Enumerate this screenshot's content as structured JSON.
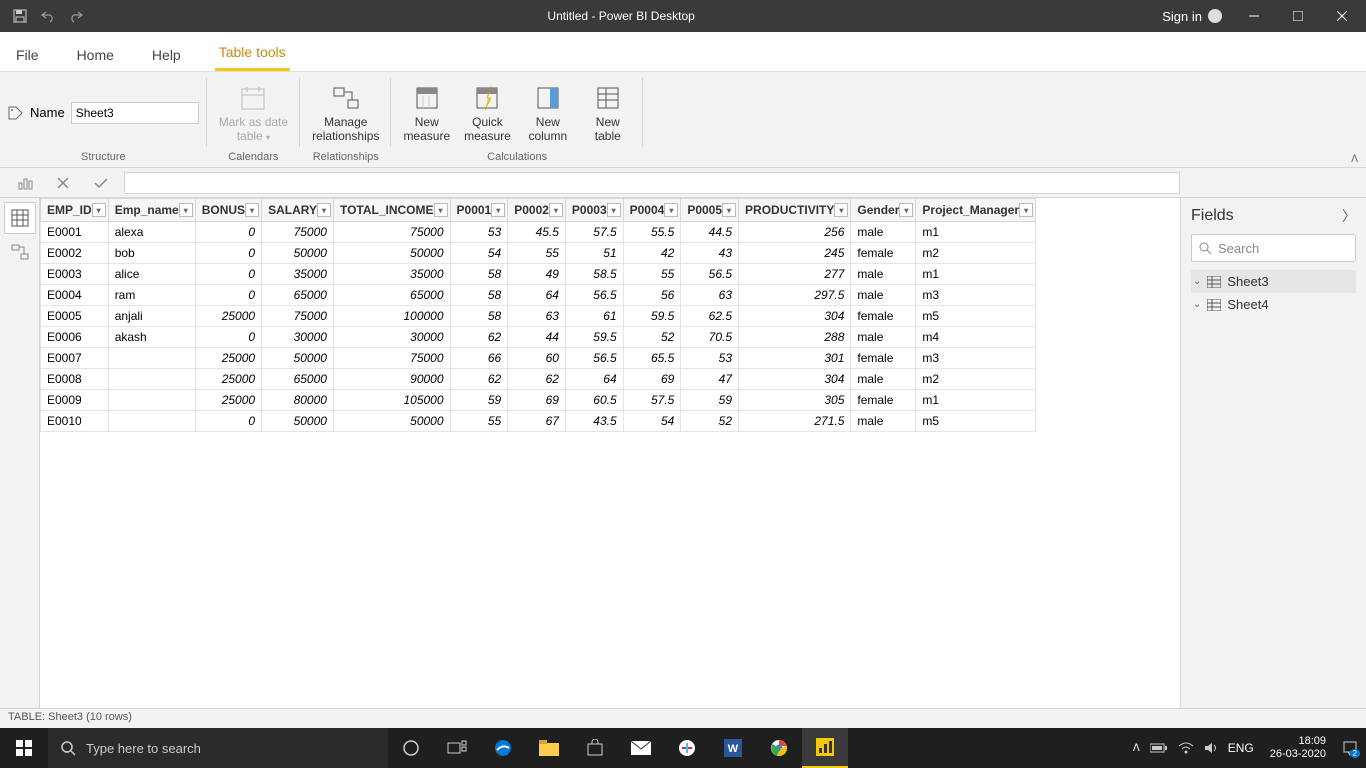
{
  "titlebar": {
    "title": "Untitled - Power BI Desktop",
    "signin": "Sign in"
  },
  "menu": {
    "file": "File",
    "home": "Home",
    "help": "Help",
    "tabletools": "Table tools"
  },
  "ribbon": {
    "name_label": "Name",
    "name_value": "Sheet3",
    "structure": "Structure",
    "mark_as_date": "Mark as date table",
    "calendars": "Calendars",
    "manage_rel": "Manage relationships",
    "relationships": "Relationships",
    "new_measure": "New measure",
    "quick_measure": "Quick measure",
    "new_column": "New column",
    "new_table": "New table",
    "calculations": "Calculations"
  },
  "columns": [
    "EMP_ID",
    "Emp_name",
    "BONUS",
    "SALARY",
    "TOTAL_INCOME",
    "P0001",
    "P0002",
    "P0003",
    "P0004",
    "P0005",
    "PRODUCTIVITY",
    "Gender",
    "Project_Manager"
  ],
  "col_types": [
    "text",
    "text",
    "num",
    "num",
    "num",
    "num",
    "num",
    "num",
    "num",
    "num",
    "num",
    "text",
    "text"
  ],
  "rows": [
    [
      "E0001",
      "alexa",
      "0",
      "75000",
      "75000",
      "53",
      "45.5",
      "57.5",
      "55.5",
      "44.5",
      "256",
      "male",
      "m1"
    ],
    [
      "E0002",
      "bob",
      "0",
      "50000",
      "50000",
      "54",
      "55",
      "51",
      "42",
      "43",
      "245",
      "female",
      "m2"
    ],
    [
      "E0003",
      "alice",
      "0",
      "35000",
      "35000",
      "58",
      "49",
      "58.5",
      "55",
      "56.5",
      "277",
      "male",
      "m1"
    ],
    [
      "E0004",
      "ram",
      "0",
      "65000",
      "65000",
      "58",
      "64",
      "56.5",
      "56",
      "63",
      "297.5",
      "male",
      "m3"
    ],
    [
      "E0005",
      "anjali",
      "25000",
      "75000",
      "100000",
      "58",
      "63",
      "61",
      "59.5",
      "62.5",
      "304",
      "female",
      "m5"
    ],
    [
      "E0006",
      "akash",
      "0",
      "30000",
      "30000",
      "62",
      "44",
      "59.5",
      "52",
      "70.5",
      "288",
      "male",
      "m4"
    ],
    [
      "E0007",
      "",
      "25000",
      "50000",
      "75000",
      "66",
      "60",
      "56.5",
      "65.5",
      "53",
      "301",
      "female",
      "m3"
    ],
    [
      "E0008",
      "",
      "25000",
      "65000",
      "90000",
      "62",
      "62",
      "64",
      "69",
      "47",
      "304",
      "male",
      "m2"
    ],
    [
      "E0009",
      "",
      "25000",
      "80000",
      "105000",
      "59",
      "69",
      "60.5",
      "57.5",
      "59",
      "305",
      "female",
      "m1"
    ],
    [
      "E0010",
      "",
      "0",
      "50000",
      "50000",
      "55",
      "67",
      "43.5",
      "54",
      "52",
      "271.5",
      "male",
      "m5"
    ]
  ],
  "fields": {
    "title": "Fields",
    "search": "Search",
    "items": [
      "Sheet3",
      "Sheet4"
    ],
    "selected": 0
  },
  "status": "TABLE: Sheet3 (10 rows)",
  "taskbar": {
    "search": "Type here to search",
    "lang": "ENG",
    "time": "18:09",
    "date": "26-03-2020"
  }
}
